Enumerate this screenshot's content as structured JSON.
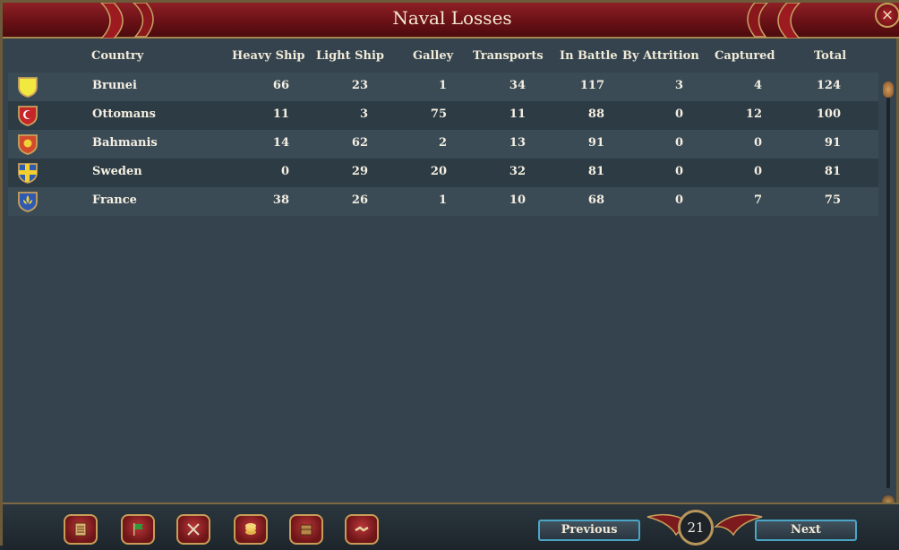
{
  "window": {
    "title": "Naval Losses",
    "close_label": "×"
  },
  "columns": [
    "Country",
    "Heavy Ship",
    "Light Ship",
    "Galley",
    "Transports",
    "In Battle",
    "By Attrition",
    "Captured",
    "Total"
  ],
  "rows": [
    {
      "country": "Brunei",
      "heavy": "66",
      "light": "23",
      "galley": "1",
      "transports": "34",
      "battle": "117",
      "attrition": "3",
      "captured": "4",
      "total": "124",
      "flag_colors": [
        "#f1e93f",
        "#e7d52d"
      ],
      "flag_icon": "plain-yellow-flag-icon"
    },
    {
      "country": "Ottomans",
      "heavy": "11",
      "light": "3",
      "galley": "75",
      "transports": "11",
      "battle": "88",
      "attrition": "0",
      "captured": "12",
      "total": "100",
      "flag_colors": [
        "#c5262a",
        "#ffffff"
      ],
      "flag_icon": "crescent-flag-icon"
    },
    {
      "country": "Bahmanis",
      "heavy": "14",
      "light": "62",
      "galley": "2",
      "transports": "13",
      "battle": "91",
      "attrition": "0",
      "captured": "0",
      "total": "91",
      "flag_colors": [
        "#d24a2b",
        "#f1d13a"
      ],
      "flag_icon": "sun-flag-icon"
    },
    {
      "country": "Sweden",
      "heavy": "0",
      "light": "29",
      "galley": "20",
      "transports": "32",
      "battle": "81",
      "attrition": "0",
      "captured": "0",
      "total": "81",
      "flag_colors": [
        "#2e5cae",
        "#f2cf2d"
      ],
      "flag_icon": "cross-flag-icon"
    },
    {
      "country": "France",
      "heavy": "38",
      "light": "26",
      "galley": "1",
      "transports": "10",
      "battle": "68",
      "attrition": "0",
      "captured": "7",
      "total": "75",
      "flag_colors": [
        "#2f5ab0",
        "#f0d23c"
      ],
      "flag_icon": "fleur-de-lis-flag-icon"
    }
  ],
  "nav": {
    "previous_label": "Previous",
    "next_label": "Next",
    "page": "21"
  },
  "bottom_icons": [
    "ledger-icon",
    "green-flag-icon",
    "crossed-swords-icon",
    "coins-icon",
    "crate-icon",
    "handshake-icon"
  ]
}
